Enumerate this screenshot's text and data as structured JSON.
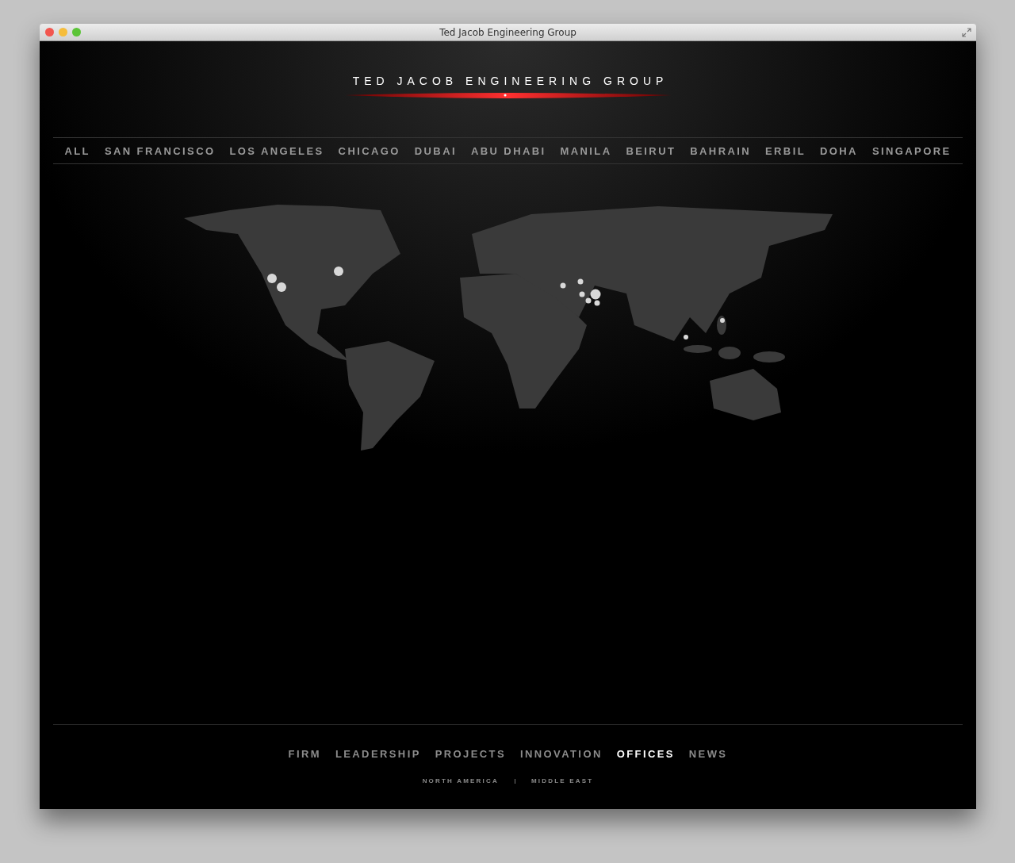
{
  "window": {
    "title": "Ted Jacob Engineering Group"
  },
  "logo": {
    "text": "TED JACOB ENGINEERING GROUP"
  },
  "office_filter": [
    {
      "label": "ALL",
      "selected": false
    },
    {
      "label": "SAN FRANCISCO",
      "selected": false
    },
    {
      "label": "LOS ANGELES",
      "selected": false
    },
    {
      "label": "CHICAGO",
      "selected": false
    },
    {
      "label": "DUBAI",
      "selected": false
    },
    {
      "label": "ABU DHABI",
      "selected": false
    },
    {
      "label": "MANILA",
      "selected": false
    },
    {
      "label": "BEIRUT",
      "selected": false
    },
    {
      "label": "BAHRAIN",
      "selected": false
    },
    {
      "label": "ERBIL",
      "selected": false
    },
    {
      "label": "DOHA",
      "selected": false
    },
    {
      "label": "SINGAPORE",
      "selected": false
    }
  ],
  "main_nav": [
    {
      "label": "FIRM",
      "selected": false
    },
    {
      "label": "LEADERSHIP",
      "selected": false
    },
    {
      "label": "PROJECTS",
      "selected": false
    },
    {
      "label": "INNOVATION",
      "selected": false
    },
    {
      "label": "OFFICES",
      "selected": true
    },
    {
      "label": "NEWS",
      "selected": false
    }
  ],
  "sub_nav": [
    "NORTH AMERICA",
    "MIDDLE EAST"
  ]
}
